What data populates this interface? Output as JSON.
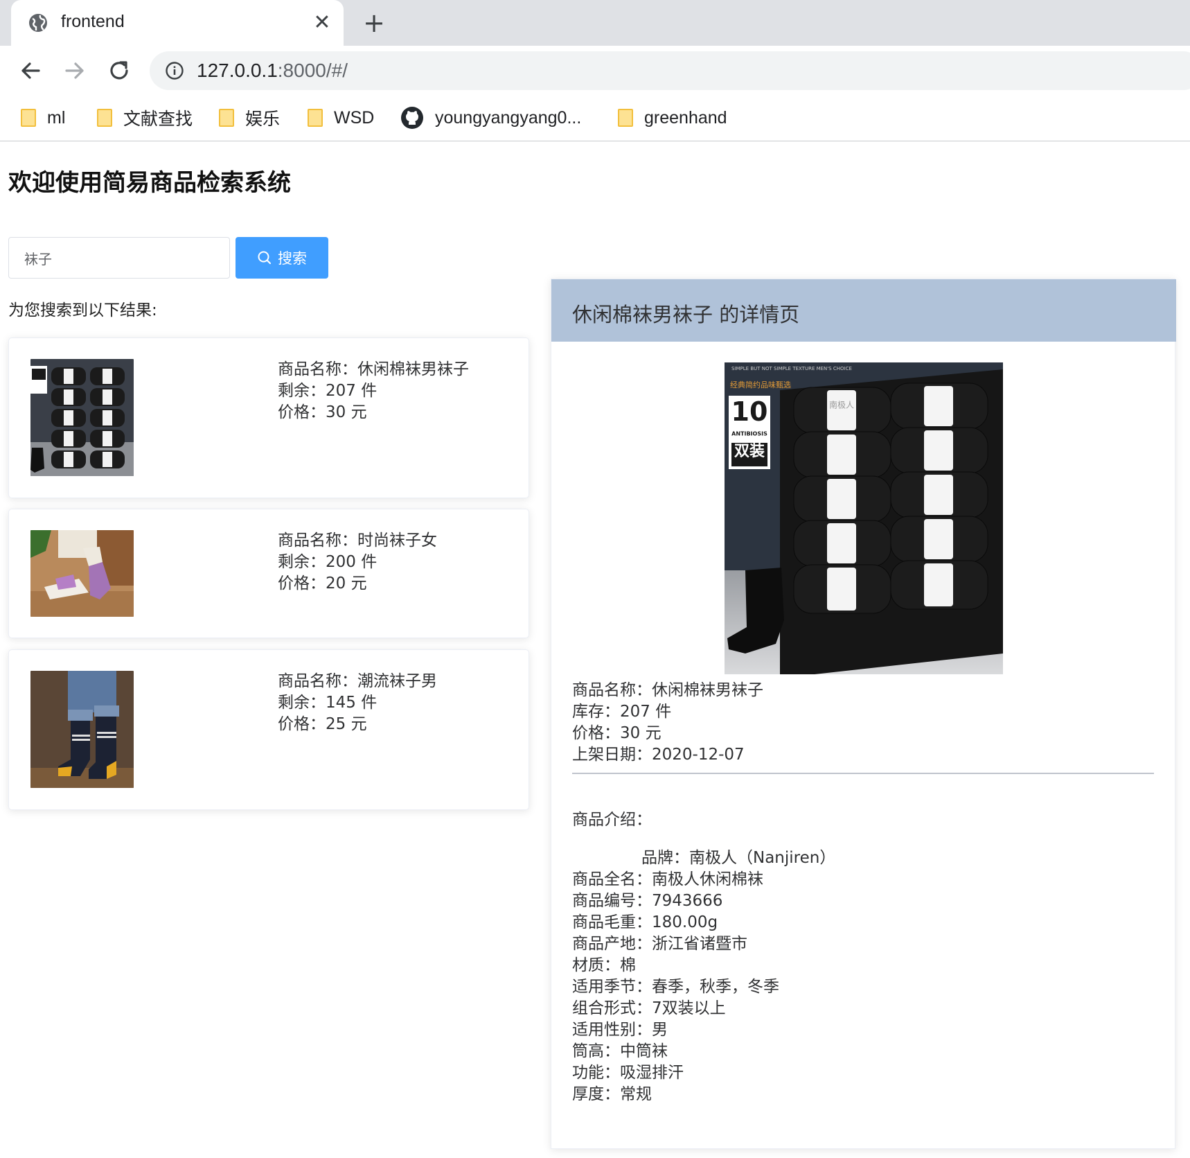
{
  "browser": {
    "tab_title": "frontend",
    "url_host": "127.0.0.1",
    "url_path": ":8000/#/",
    "bookmarks": [
      {
        "label": "ml",
        "icon": "folder-icon"
      },
      {
        "label": "文献查找",
        "icon": "folder-icon"
      },
      {
        "label": "娱乐",
        "icon": "folder-icon"
      },
      {
        "label": "WSD",
        "icon": "folder-icon"
      },
      {
        "label": "youngyangyang0...",
        "icon": "github-icon"
      },
      {
        "label": "greenhand",
        "icon": "folder-icon"
      }
    ]
  },
  "page": {
    "title": "欢迎使用简易商品检索系统",
    "search": {
      "value": "袜子",
      "placeholder": "袜子",
      "button_label": "搜索"
    },
    "results_caption": "为您搜索到以下结果:",
    "results": [
      {
        "name_line": "商品名称：休闲棉袜男袜子",
        "stock_line": "剩余：207 件",
        "price_line": "价格：30 元"
      },
      {
        "name_line": "商品名称：时尚袜子女",
        "stock_line": "剩余：200 件",
        "price_line": "价格：20 元"
      },
      {
        "name_line": "商品名称：潮流袜子男",
        "stock_line": "剩余：145 件",
        "price_line": "价格：25 元"
      }
    ],
    "detail": {
      "header": "休闲棉袜男袜子 的详情页",
      "name_line": "商品名称：休闲棉袜男袜子",
      "stock_line": "库存：207 件",
      "price_line": "价格：30 元",
      "date_line": "上架日期：2020-12-07",
      "intro_label": "商品介绍：",
      "intro": [
        "品牌：南极人（Nanjiren）",
        "商品全名：南极人休闲棉袜",
        "商品编号：7943666",
        "商品毛重：180.00g",
        "商品产地：浙江省诸暨市",
        "材质：棉",
        "适用季节：春季，秋季，冬季",
        "组合形式：7双装以上",
        "适用性别：男",
        "筒高：中筒袜",
        "功能：吸湿排汗",
        "厚度：常规"
      ],
      "image_text": {
        "banner": "SIMPLE BUT NOT SIMPLE TEXTURE MEN'S CHOICE",
        "tagline": "经典简约品味甄选",
        "count": "10",
        "sub": "ANTIBIOSIS",
        "pack": "双装",
        "brand": "南极人"
      }
    }
  },
  "colors": {
    "primary": "#409eff",
    "detail_header": "#b0c2d9",
    "tabstrip": "#dfe1e5"
  }
}
